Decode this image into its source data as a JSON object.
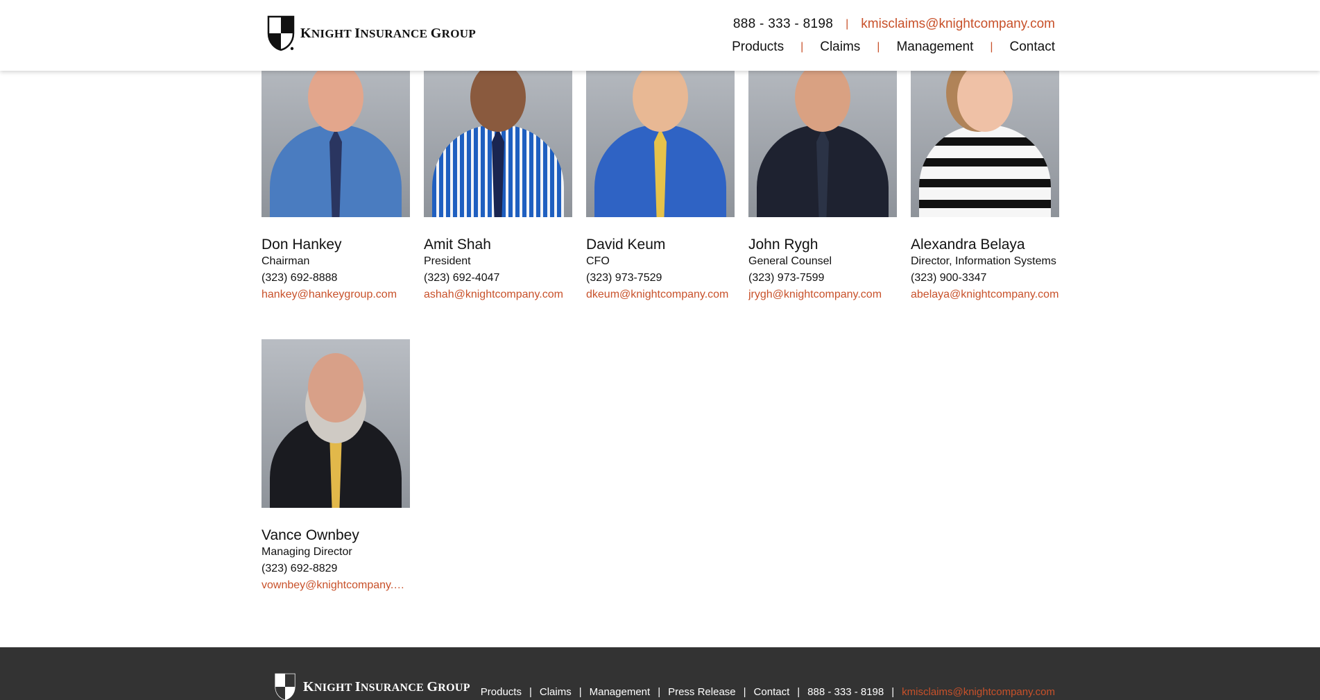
{
  "brand": {
    "name_initial_1": "K",
    "name_rest_1": "NIGHT ",
    "name_initial_2": "I",
    "name_rest_2": "NSURANCE ",
    "name_initial_3": "G",
    "name_rest_3": "ROUP"
  },
  "header": {
    "phone": "888 - 333 - 8198",
    "email": "kmisclaims@knightcompany.com",
    "nav": [
      "Products",
      "Claims",
      "Management",
      "Contact"
    ]
  },
  "team": [
    {
      "name": "Don Hankey",
      "title": "Chairman",
      "phone": "(323) 692-8888",
      "email": "hankey@hankeygroup.com"
    },
    {
      "name": "Amit Shah",
      "title": "President",
      "phone": "(323) 692-4047",
      "email": "ashah@knightcompany.com"
    },
    {
      "name": "David Keum",
      "title": "CFO",
      "phone": "(323) 973-7529",
      "email": "dkeum@knightcompany.com"
    },
    {
      "name": "John Rygh",
      "title": "General Counsel",
      "phone": "(323) 973-7599",
      "email": "jrygh@knightcompany.com"
    },
    {
      "name": "Alexandra Belaya",
      "title": "Director, Information Systems",
      "phone": "(323) 900-3347",
      "email": "abelaya@knightcompany.com"
    },
    {
      "name": "Vance Ownbey",
      "title": "Managing Director",
      "phone": "(323) 692-8829",
      "email": "vownbey@knightcompany.com"
    }
  ],
  "footer": {
    "nav": [
      "Products",
      "Claims",
      "Management",
      "Press Release",
      "Contact"
    ],
    "phone": "888 - 333 - 8198",
    "email": "kmisclaims@knightcompany.com"
  },
  "colors": {
    "accent": "#c8512a",
    "footer_bg": "#333333"
  }
}
